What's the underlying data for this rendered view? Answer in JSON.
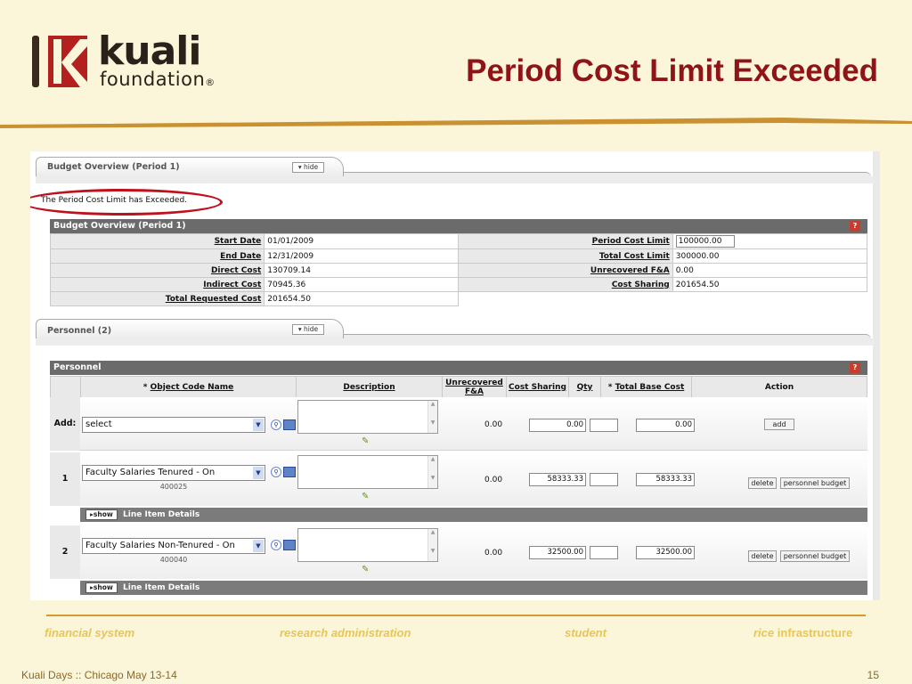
{
  "slide": {
    "logo_word": "kuali",
    "logo_sub": "foundation",
    "logo_mark": "®",
    "title": "Period Cost Limit Exceeded",
    "footer_left": "Kuali Days :: Chicago May 13-14",
    "page_number": "15",
    "nav": [
      "financial system",
      "research administration",
      "student",
      "rice",
      "infrastructure"
    ]
  },
  "budget_tab": {
    "label": "Budget Overview (Period 1)",
    "hide_label": "▾ hide",
    "message": "The Period Cost Limit has Exceeded.",
    "section_title": "Budget Overview (Period 1)",
    "help": "?",
    "rows": [
      {
        "l1": "Start Date",
        "v1": "01/01/2009",
        "l2": "Period Cost Limit",
        "v2": "100000.00"
      },
      {
        "l1": "End Date",
        "v1": "12/31/2009",
        "l2": "Total Cost Limit",
        "v2": "300000.00"
      },
      {
        "l1": "Direct Cost",
        "v1": "130709.14",
        "l2": "Unrecovered F&A",
        "v2": "0.00"
      },
      {
        "l1": "Indirect Cost",
        "v1": "70945.36",
        "l2": "Cost Sharing",
        "v2": "201654.50"
      },
      {
        "l1": "Total Requested Cost",
        "v1": "201654.50"
      }
    ]
  },
  "personnel_tab": {
    "label": "Personnel (2)",
    "hide_label": "▾ hide",
    "section_title": "Personnel",
    "help": "?",
    "headers": {
      "object_code": "Object Code Name",
      "description": "Description",
      "unrecovered": "Unrecovered F&A",
      "cost_sharing": "Cost Sharing",
      "qty": "Qty",
      "total_base_cost": "Total Base Cost",
      "action": "Action",
      "required_mark": "*"
    },
    "add_row": {
      "label": "Add:",
      "select": "select",
      "unrecovered": "0.00",
      "cost_sharing": "0.00",
      "total_base_cost": "0.00",
      "add_button": "add"
    },
    "rows": [
      {
        "num": "1",
        "object_code": "Faculty Salaries Tenured - On",
        "code": "400025",
        "unrecovered": "0.00",
        "cost_sharing": "58333.33",
        "total_base_cost": "58333.33",
        "delete": "delete",
        "personnel_budget": "personnel budget"
      },
      {
        "num": "2",
        "object_code": "Faculty Salaries Non-Tenured - On",
        "code": "400040",
        "unrecovered": "0.00",
        "cost_sharing": "32500.00",
        "total_base_cost": "32500.00",
        "delete": "delete",
        "personnel_budget": "personnel budget"
      }
    ],
    "show_label": "▸show",
    "line_item_details": "Line Item Details"
  },
  "icons": [
    "search-icon",
    "book-icon",
    "pencil-icon",
    "chevron-down-icon",
    "help-icon"
  ],
  "colors": {
    "title": "#8f1418",
    "background": "#fbf5d9",
    "accent": "#d49a2f",
    "ring": "#c0101b"
  }
}
